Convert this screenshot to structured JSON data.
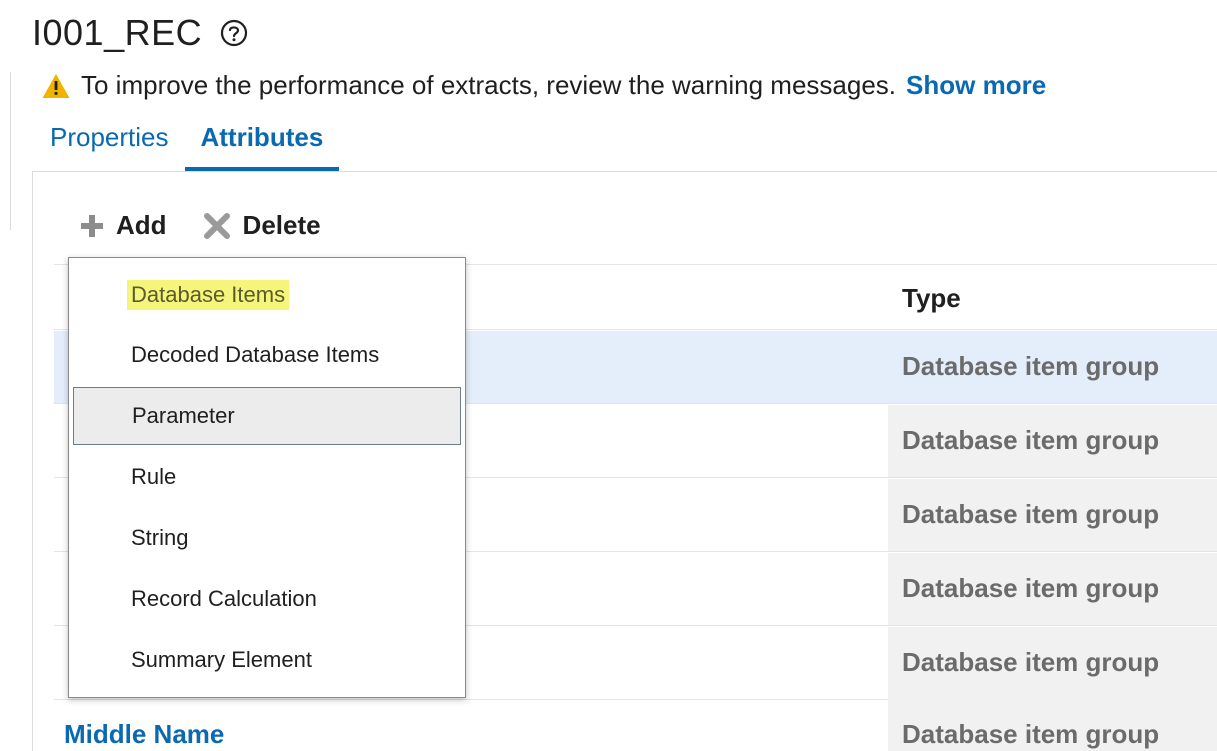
{
  "header": {
    "title": "I001_REC",
    "help_icon": "help-circle-icon"
  },
  "warning": {
    "icon": "warning-triangle-icon",
    "color": "#f0b400",
    "text": "To improve the performance of extracts, review the warning messages.",
    "link": "Show more"
  },
  "tabs": [
    {
      "label": "Properties",
      "active": false
    },
    {
      "label": "Attributes",
      "active": true
    }
  ],
  "toolbar": {
    "add_label": "Add",
    "add_icon": "plus-icon",
    "delete_label": "Delete",
    "delete_icon": "x-icon"
  },
  "table": {
    "columns": [
      "Type"
    ],
    "rows": [
      {
        "name": "",
        "type": "Database item group",
        "selected": true
      },
      {
        "name": "",
        "type": "Database item group",
        "selected": false
      },
      {
        "name": "",
        "type": "Database item group",
        "selected": false
      },
      {
        "name": "",
        "type": "Database item group",
        "selected": false
      },
      {
        "name": "",
        "type": "Database item group",
        "selected": false
      },
      {
        "name": "Middle Name",
        "type": "Database item group",
        "selected": false
      }
    ]
  },
  "add_menu": {
    "items": [
      {
        "label": "Database Items",
        "highlighted": true,
        "focused": false
      },
      {
        "label": "Decoded Database Items",
        "highlighted": false,
        "focused": false
      },
      {
        "label": "Parameter",
        "highlighted": false,
        "focused": true
      },
      {
        "label": "Rule",
        "highlighted": false,
        "focused": false
      },
      {
        "label": "String",
        "highlighted": false,
        "focused": false
      },
      {
        "label": "Record Calculation",
        "highlighted": false,
        "focused": false
      },
      {
        "label": "Summary Element",
        "highlighted": false,
        "focused": false
      }
    ]
  },
  "colors": {
    "accent": "#0a6ab1",
    "selected_row": "#e4eefa",
    "highlight": "#f4f57a"
  }
}
